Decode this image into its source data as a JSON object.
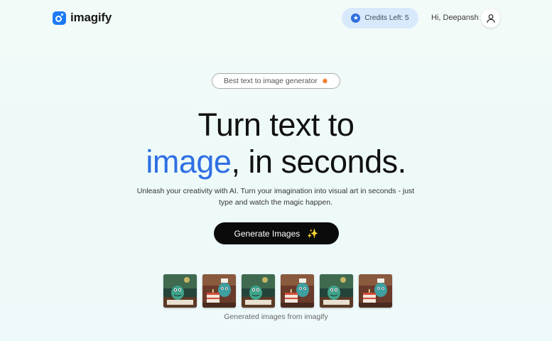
{
  "header": {
    "logo_text": "imagify",
    "credits_label": "Credits Left: 5",
    "greeting": "Hi, Deepansh"
  },
  "hero": {
    "badge_text": "Best text to image generator",
    "headline_line1": "Turn text to",
    "headline_accent": "image",
    "headline_rest": ", in seconds.",
    "subtext": "Unleash your creativity with AI. Turn your imagination into visual art in seconds - just type and watch the magic happen.",
    "cta_label": "Generate Images"
  },
  "gallery": {
    "caption": "Generated images from imagify",
    "images": [
      {
        "variant": "monster-forest"
      },
      {
        "variant": "monster-cake"
      },
      {
        "variant": "monster-forest"
      },
      {
        "variant": "monster-cake"
      },
      {
        "variant": "monster-forest"
      },
      {
        "variant": "monster-cake"
      }
    ]
  },
  "colors": {
    "accent": "#2f6fe4",
    "logo": "#1d7af5",
    "credits_bg": "#d8e9fb",
    "cta_bg": "#0b0b0b"
  },
  "icons": {
    "logo": "imagify-logo-icon",
    "credits": "star-icon",
    "avatar": "user-icon",
    "badge": "star-icon",
    "cta": "sparkle-icon"
  }
}
